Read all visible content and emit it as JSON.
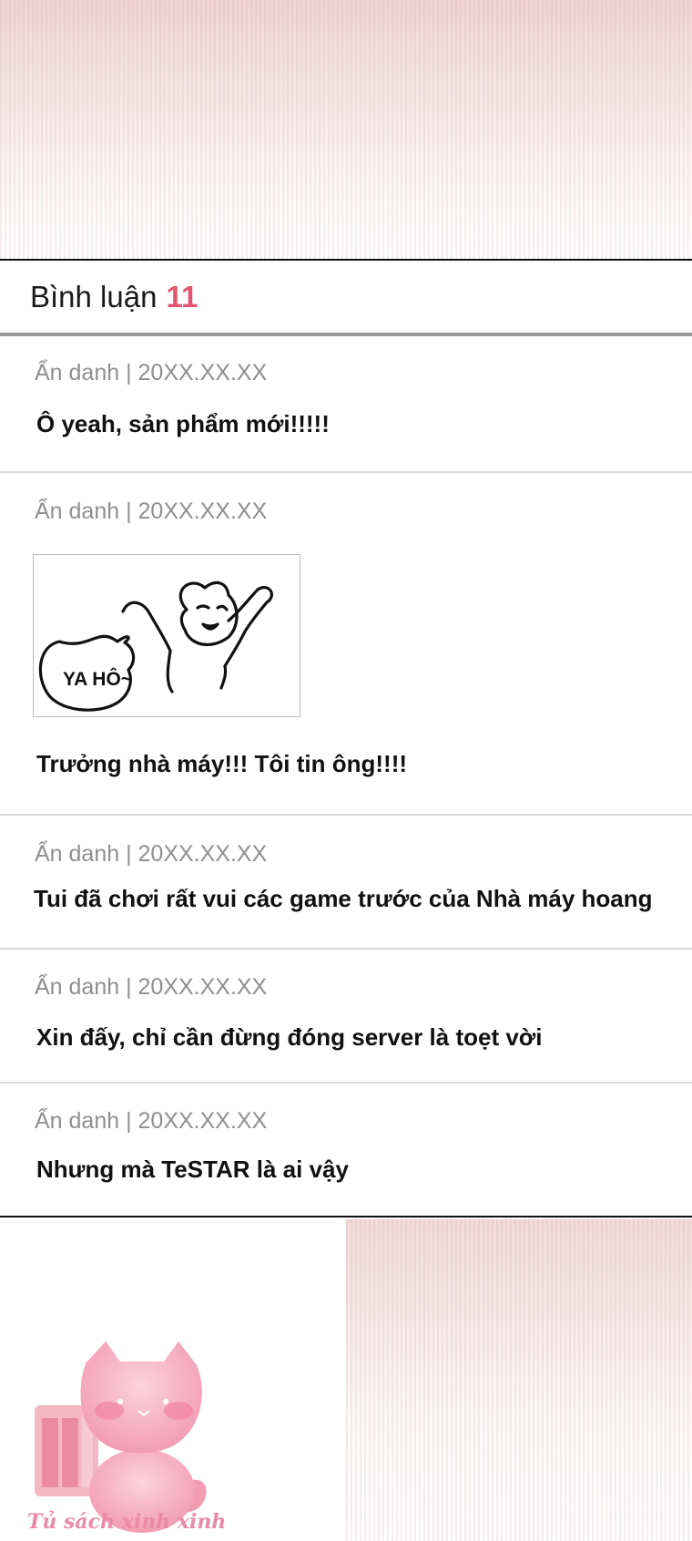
{
  "header": {
    "title": "Bình luận",
    "count": "11"
  },
  "comments": [
    {
      "meta": "Ẩn danh | 20XX.XX.XX",
      "text": "Ô yeah, sản phẩm mới!!!!!"
    },
    {
      "meta": "Ẩn danh | 20XX.XX.XX",
      "sticker_text": "YA HÔ~",
      "text": "Trưởng nhà máy!!! Tôi tin ông!!!!"
    },
    {
      "meta": "Ẩn danh | 20XX.XX.XX",
      "text": "Tui đã chơi rất vui các game trước của Nhà máy hoang"
    },
    {
      "meta": "Ẩn danh | 20XX.XX.XX",
      "text": "Xin đấy, chỉ cần đừng đóng server là toẹt vời"
    },
    {
      "meta": "Ẩn danh | 20XX.XX.XX",
      "text": "Nhưng mà TeSTAR là ai vậy"
    }
  ],
  "watermark": {
    "text": "Tủ sách xinh xinh",
    "icon": "pink-cat-bookshelf-logo"
  },
  "colors": {
    "accent": "#e0566e",
    "meta": "#8f8f8f",
    "watermark": "#e98aa6"
  }
}
